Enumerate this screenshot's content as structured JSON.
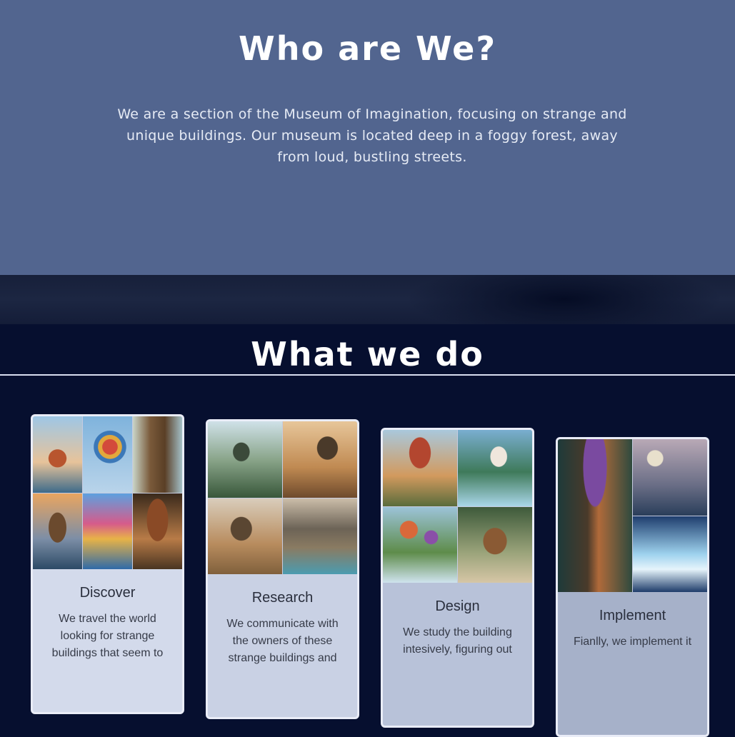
{
  "about": {
    "title": "Who are We?",
    "text": "We are a section of the Museum of Imagination, focusing on strange and unique buildings. Our museum is located deep in a foggy forest, away from loud, bustling streets."
  },
  "what_we_do": {
    "title": "What we do",
    "cards": [
      {
        "title": "Discover",
        "text": "We travel the world looking for strange buildings that seem to",
        "image": "spiral-tower-balloon-tree-collage"
      },
      {
        "title": "Research",
        "text": "We communicate with the owners of these strange buildings and",
        "image": "floating-spiral-ramps-collage"
      },
      {
        "title": "Design",
        "text": "We study the building intesively, figuring out",
        "image": "tree-house-floating-islands-collage"
      },
      {
        "title": "Implement",
        "text": "Fianlly, we implement it",
        "image": "spiral-mushroom-tower-crystal-collage"
      }
    ]
  },
  "colors": {
    "about_bg": "#52658f",
    "dark_bg": "#060f2f",
    "card_bg": [
      "#d3daeb",
      "#c9d1e4",
      "#b8c2d9",
      "#a6b1c9"
    ]
  }
}
